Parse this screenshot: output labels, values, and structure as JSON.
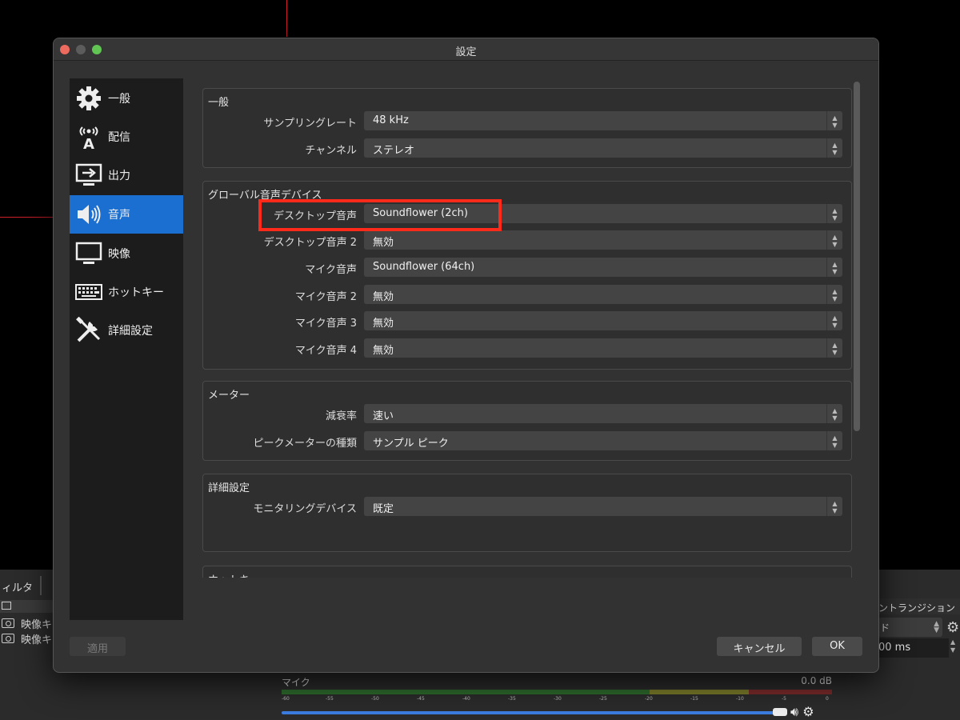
{
  "background": {
    "filter_tab": "ィルタ",
    "sources": [
      "映像キ",
      "映像キ"
    ],
    "transition_title": "ントランジション",
    "transition_select": "ド",
    "duration": "00 ms",
    "mixer": {
      "name": "マイク",
      "db": "0.0 dB",
      "ticks": [
        "-60",
        "-55",
        "-50",
        "-45",
        "-40",
        "-35",
        "-30",
        "-25",
        "-20",
        "-15",
        "-10",
        "-5",
        "0"
      ]
    }
  },
  "dialog": {
    "title": "設定",
    "sidebar": [
      {
        "label": "一般",
        "icon": "gear-icon"
      },
      {
        "label": "配信",
        "icon": "broadcast-icon"
      },
      {
        "label": "出力",
        "icon": "output-icon"
      },
      {
        "label": "音声",
        "icon": "speaker-icon",
        "active": true
      },
      {
        "label": "映像",
        "icon": "monitor-icon"
      },
      {
        "label": "ホットキー",
        "icon": "keyboard-icon"
      },
      {
        "label": "詳細設定",
        "icon": "tools-icon"
      }
    ],
    "groups": {
      "general": {
        "title": "一般",
        "rows": [
          {
            "label": "サンプリングレート",
            "value": "48 kHz"
          },
          {
            "label": "チャンネル",
            "value": "ステレオ"
          }
        ]
      },
      "global_devices": {
        "title": "グローバル音声デバイス",
        "rows": [
          {
            "label": "デスクトップ音声",
            "value": "Soundflower (2ch)"
          },
          {
            "label": "デスクトップ音声 2",
            "value": "無効"
          },
          {
            "label": "マイク音声",
            "value": "Soundflower (64ch)"
          },
          {
            "label": "マイク音声 2",
            "value": "無効"
          },
          {
            "label": "マイク音声 3",
            "value": "無効"
          },
          {
            "label": "マイク音声 4",
            "value": "無効"
          }
        ]
      },
      "meters": {
        "title": "メーター",
        "rows": [
          {
            "label": "減衰率",
            "value": "速い"
          },
          {
            "label": "ピークメーターの種類",
            "value": "サンプル ピーク"
          }
        ]
      },
      "advanced": {
        "title": "詳細設定",
        "rows": [
          {
            "label": "モニタリングデバイス",
            "value": "既定"
          }
        ]
      },
      "hotkeys": {
        "title": "ホットキー"
      }
    },
    "buttons": {
      "apply": "適用",
      "cancel": "キャンセル",
      "ok": "OK"
    }
  }
}
